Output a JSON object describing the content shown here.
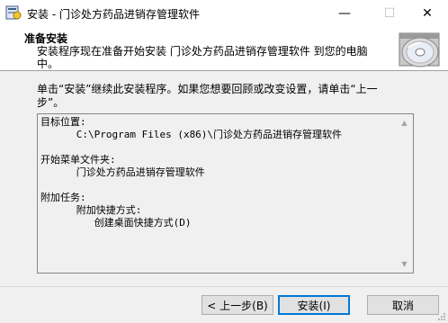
{
  "window": {
    "title": "安装 - 门诊处方药品进销存管理软件",
    "minimize_glyph": "—",
    "maximize_glyph": "☐",
    "close_glyph": "✕"
  },
  "header": {
    "title": "准备安装",
    "subtitle": "安装程序现在准备开始安装 门诊处方药品进销存管理软件 到您的电脑中。",
    "icon": "setup-disc-icon"
  },
  "instruction": "单击“安装”继续此安装程序。如果您想要回顾或改变设置，请单击“上一步”。",
  "memo": {
    "lines": [
      "目标位置:",
      "      C:\\Program Files (x86)\\门诊处方药品进销存管理软件",
      "",
      "开始菜单文件夹:",
      "      门诊处方药品进销存管理软件",
      "",
      "附加任务:",
      "      附加快捷方式:",
      "         创建桌面快捷方式(D)"
    ]
  },
  "buttons": {
    "back": "< 上一步(B)",
    "install": "安装(I)",
    "cancel": "取消"
  },
  "colors": {
    "accent": "#0078d7",
    "header_bg": "#ffffff",
    "body_bg": "#f0f0f0"
  }
}
